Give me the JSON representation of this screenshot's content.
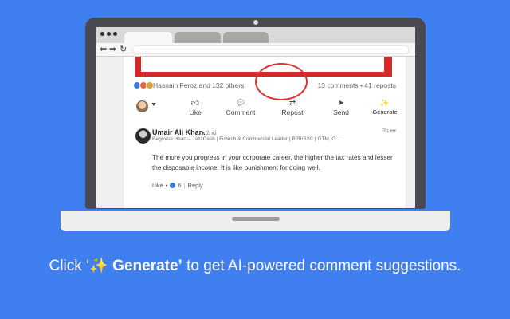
{
  "browser": {
    "nav_icons": [
      "back-arrow-icon",
      "forward-arrow-icon",
      "refresh-icon"
    ]
  },
  "post": {
    "reaction_icons": [
      "like-reaction-icon",
      "celebrate-reaction-icon",
      "support-reaction-icon"
    ],
    "likers": "Hasnain Feroz and 132 others",
    "counts": "13 comments • 41 reposts"
  },
  "actions": {
    "like": "Like",
    "comment": "Comment",
    "repost": "Repost",
    "send": "Send",
    "generate": "Generate"
  },
  "comment": {
    "name": "Umair Ali Khan.",
    "degree": "• 2nd",
    "time": "3h •••",
    "headline": "Regional Head – JazzCash | Fintech & Commercial Leader | B2B/B2C | GTM, O...",
    "text": "The more you progress in your corporate career, the higher the tax rates and lesser the disposable income. It is like punishment for doing well.",
    "like_label": "Like",
    "separator1": "•",
    "like_count": "6",
    "separator2": "|",
    "reply_label": "Reply"
  },
  "caption": {
    "prefix": "Click ‘",
    "sparkle": "✨",
    "bold": " Generate’",
    "suffix": " to get AI-powered comment suggestions."
  },
  "colors": {
    "background": "#3f7ff0",
    "highlight_circle": "#e03030",
    "post_banner": "#d22a2a"
  }
}
